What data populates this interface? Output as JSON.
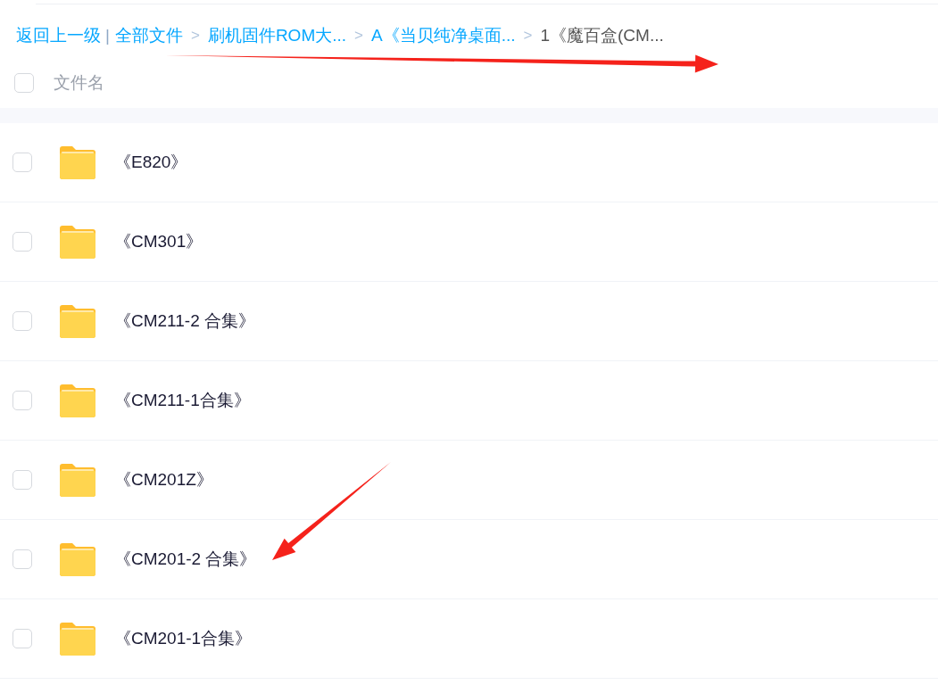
{
  "breadcrumb": {
    "back": "返回上一级",
    "separator": "|",
    "items": [
      {
        "label": "全部文件",
        "current": false
      },
      {
        "label": "刷机固件ROM大...",
        "current": false
      },
      {
        "label": "A《当贝纯净桌面...",
        "current": false
      },
      {
        "label": "1《魔百盒(CM...",
        "current": true
      }
    ],
    "arrow": ">"
  },
  "header": {
    "checked": false,
    "column": "文件名"
  },
  "rows": [
    {
      "name": "《E820》",
      "checked": false
    },
    {
      "name": "《CM301》",
      "checked": false
    },
    {
      "name": "《CM211-2 合集》",
      "checked": false
    },
    {
      "name": "《CM211-1合集》",
      "checked": false
    },
    {
      "name": "《CM201Z》",
      "checked": false
    },
    {
      "name": "《CM201-2 合集》",
      "checked": false
    },
    {
      "name": "《CM201-1合集》",
      "checked": false
    }
  ],
  "annotations": [
    {
      "kind": "arrow"
    },
    {
      "kind": "arrow"
    }
  ]
}
